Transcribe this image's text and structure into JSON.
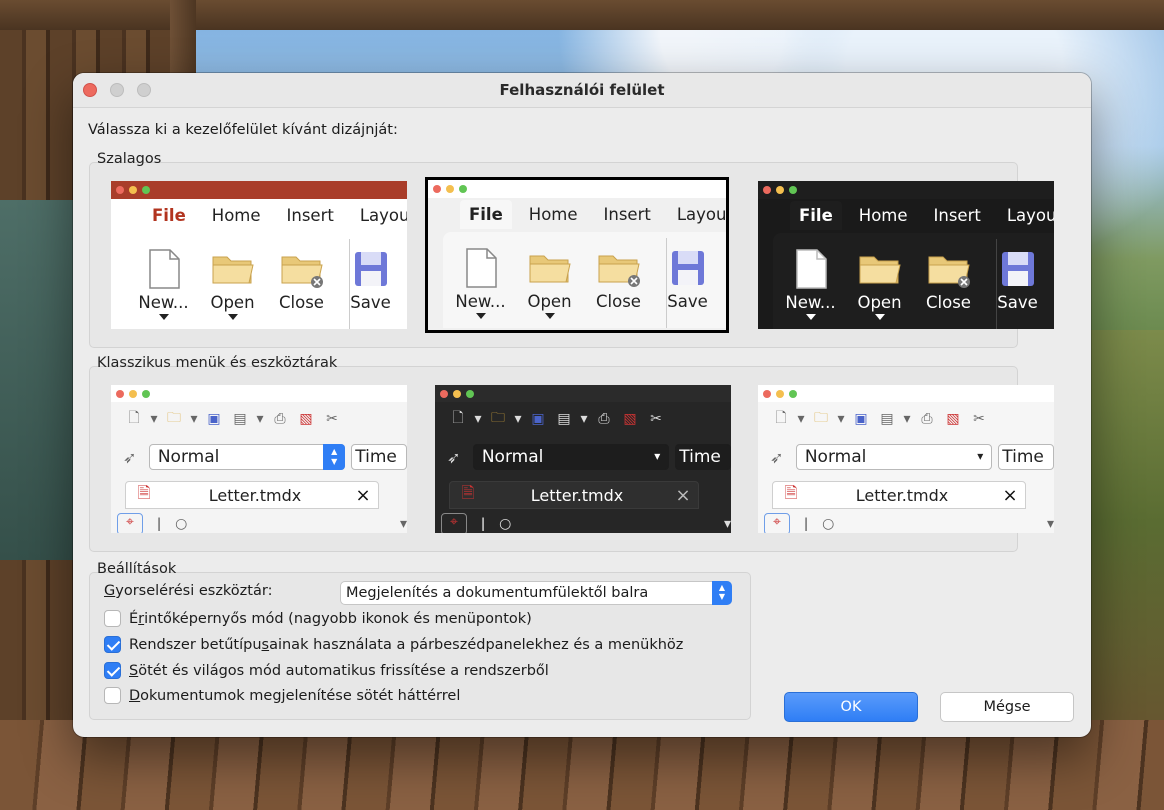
{
  "window": {
    "title": "Felhasználói felület"
  },
  "prompt": "Válassza ki a kezelőfelület kívánt dizájnját:",
  "ribbon_group": {
    "title": "Szalagos",
    "tabs": [
      "File",
      "Home",
      "Insert",
      "Layout"
    ],
    "items": [
      "New...",
      "Open",
      "Close",
      "Save"
    ],
    "themes": [
      {
        "bar": "#a93d2a",
        "active_tab_color": "#b2341f",
        "bg": "#ffffff",
        "panel": "#ffffff",
        "text": "#222222",
        "selected": false
      },
      {
        "bar": "#ffffff",
        "active_tab_color": "#222222",
        "bg": "#f0f0f0",
        "panel": "#f7f7f7",
        "text": "#222222",
        "selected": true
      },
      {
        "bar": "#1e1e1e",
        "active_tab_color": "#ffffff",
        "bg": "#1a1a1a",
        "panel": "#1e1e1e",
        "text": "#ffffff",
        "selected": false
      }
    ]
  },
  "classic_group": {
    "title": "Klasszikus menük és eszköztárak",
    "style_value": "Normal",
    "font_value": "Time",
    "doc_tab": "Letter.tmdx",
    "close_glyph": "×",
    "themes": [
      {
        "bg": "#f4f4f4",
        "text": "#222222"
      },
      {
        "bg": "#262626",
        "text": "#ffffff"
      },
      {
        "bg": "#f6f6f6",
        "text": "#222222"
      }
    ]
  },
  "settings": {
    "title": "Beállítások",
    "quick_toolbar_label_u": "G",
    "quick_toolbar_label_rest": "yorselérési eszköztár:",
    "quick_toolbar_value": "Megjelenítés a dokumentumfülektől balra",
    "options": [
      {
        "pre": "É",
        "u": "r",
        "rest": "intőképernyős mód (nagyobb ikonok és menüpontok)",
        "checked": false
      },
      {
        "pre": "Rendszer betűtípu",
        "u": "s",
        "rest": "ainak használata a párbeszédpanelekhez és a menükhöz",
        "checked": true
      },
      {
        "pre": "",
        "u": "S",
        "rest": "ötét és világos mód automatikus frissítése a rendszerből",
        "checked": true
      },
      {
        "pre": "",
        "u": "D",
        "rest": "okumentumok megjelenítése sötét háttérrel",
        "checked": false
      }
    ]
  },
  "buttons": {
    "ok": "OK",
    "cancel": "Mégse"
  },
  "colors": {
    "accent": "#2f7ef5",
    "dialog_bg": "#ececec",
    "traffic_close": "#ed6a5e"
  }
}
